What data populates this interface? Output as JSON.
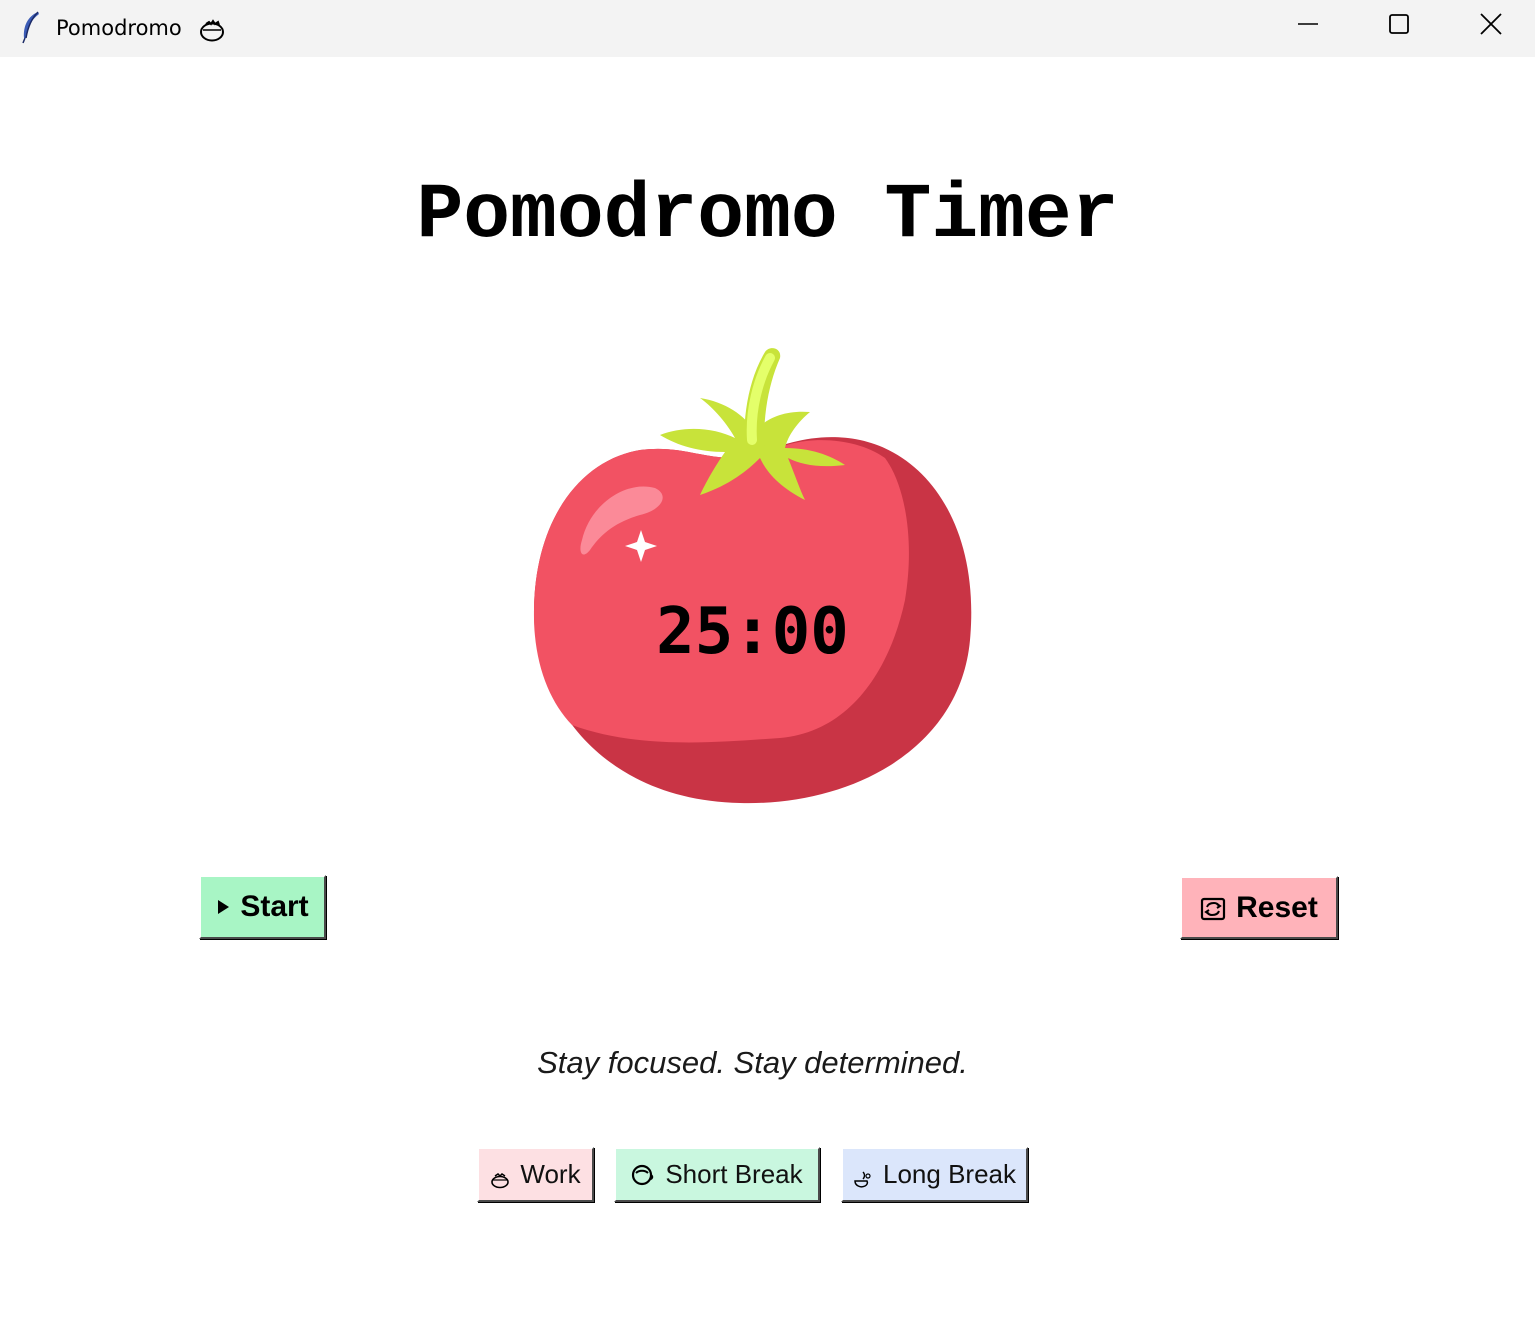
{
  "window": {
    "title": "Pomodromo",
    "title_icon": "tomato-emoji-icon",
    "app_icon": "feather-icon",
    "controls": {
      "minimize": "minimize-icon",
      "maximize": "maximize-icon",
      "close": "close-icon"
    }
  },
  "main": {
    "heading": "Pomodromo Timer",
    "timer": "25:00",
    "quote": "Stay focused. Stay determined."
  },
  "controls": {
    "start_label": "Start",
    "start_icon": "play-icon",
    "reset_label": "Reset",
    "reset_icon": "reset-icon"
  },
  "modes": [
    {
      "label": "Work",
      "icon": "tomato-icon"
    },
    {
      "label": "Short Break",
      "icon": "coffee-icon"
    },
    {
      "label": "Long Break",
      "icon": "sleep-icon"
    }
  ],
  "colors": {
    "start_bg": "#a8f5c5",
    "reset_bg": "#ffb3ba",
    "work_bg": "#fde0e3",
    "short_break_bg": "#c9f7df",
    "long_break_bg": "#dbe6fb",
    "tomato_main": "#f25263",
    "tomato_shade": "#c93445",
    "stem": "#c8e33a"
  }
}
